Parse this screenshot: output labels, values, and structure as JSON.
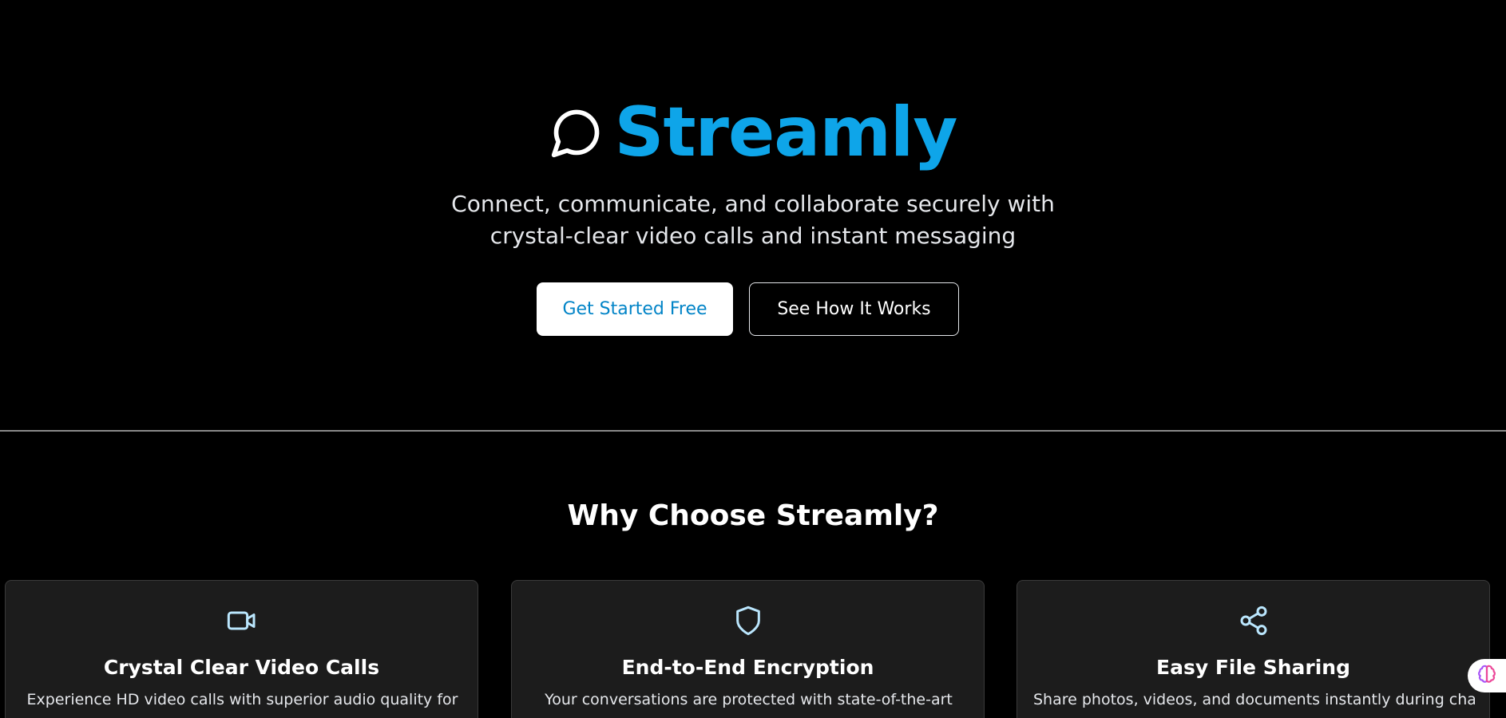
{
  "hero": {
    "brand_name": "Streamly",
    "brand_icon": "message-circle-icon",
    "tagline": "Connect, communicate, and collaborate securely with crystal-clear video calls and instant messaging",
    "primary_button": "Get Started Free",
    "secondary_button": "See How It Works"
  },
  "features": {
    "title": "Why Choose Streamly?",
    "cards": [
      {
        "icon": "video-icon",
        "title": "Crystal Clear Video Calls",
        "description": "Experience HD video calls with superior audio quality for"
      },
      {
        "icon": "shield-icon",
        "title": "End-to-End Encryption",
        "description": "Your conversations are protected with state-of-the-art"
      },
      {
        "icon": "share-icon",
        "title": "Easy File Sharing",
        "description": "Share photos, videos, and documents instantly during chats"
      }
    ]
  },
  "colors": {
    "background": "#000000",
    "brand": "#0ea5e9",
    "card_background": "#1c1c1c",
    "card_icon": "#bae6fd",
    "primary_button_text": "#0284c7"
  },
  "floating_widget": {
    "icon": "brain-icon"
  }
}
